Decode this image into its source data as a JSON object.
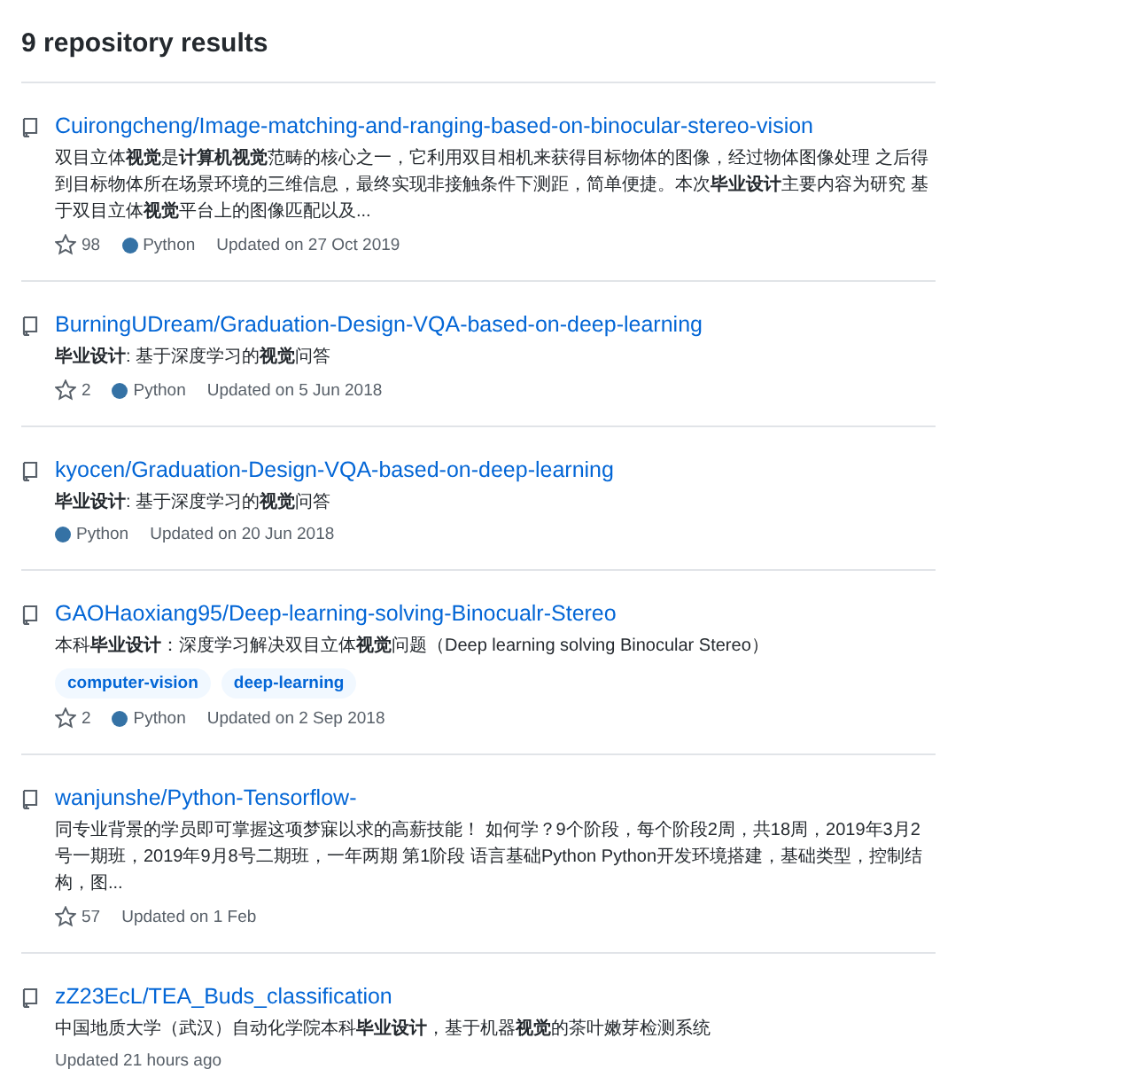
{
  "heading": "9 repository results",
  "repos": [
    {
      "name": "Cuirongcheng/Image-matching-and-ranging-based-on-binocular-stereo-vision",
      "description": "双目立体**视觉**是**计算机视觉**范畴的核心之一，它利用双目相机来获得目标物体的图像，经过物体图像处理 之后得到目标物体所在场景环境的三维信息，最终实现非接触条件下测距，简单便捷。本次**毕业设计**主要内容为研究 基于双目立体**视觉**平台上的图像匹配以及...",
      "stars": "98",
      "language": "Python",
      "color": "#3572a5",
      "updated": "Updated on 27 Oct 2019"
    },
    {
      "name": "BurningUDream/Graduation-Design-VQA-based-on-deep-learning",
      "description": "**毕业设计**: 基于深度学习的**视觉**问答",
      "stars": "2",
      "language": "Python",
      "color": "#3572a5",
      "updated": "Updated on 5 Jun 2018"
    },
    {
      "name": "kyocen/Graduation-Design-VQA-based-on-deep-learning",
      "description": "**毕业设计**: 基于深度学习的**视觉**问答",
      "language": "Python",
      "color": "#3572a5",
      "updated": "Updated on 20 Jun 2018"
    },
    {
      "name": "GAOHaoxiang95/Deep-learning-solving-Binocualr-Stereo",
      "description": "本科**毕业设计**：深度学习解决双目立体**视觉**问题（Deep learning solving Binocular Stereo）",
      "topics": [
        "computer-vision",
        "deep-learning"
      ],
      "stars": "2",
      "language": "Python",
      "color": "#3572a5",
      "updated": "Updated on 2 Sep 2018"
    },
    {
      "name": "wanjunshe/Python-Tensorflow-",
      "description": "同专业背景的学员即可掌握这项梦寐以求的高薪技能！ 如何学？9个阶段，每个阶段2周，共18周，2019年3月2号一期班，2019年9月8号二期班，一年两期 第1阶段 语言基础Python Python开发环境搭建，基础类型，控制结构，图...",
      "stars": "57",
      "updated": "Updated on 1 Feb"
    },
    {
      "name": "zZ23EcL/TEA_Buds_classification",
      "description": "中国地质大学（武汉）自动化学院本科**毕业设计**，基于机器**视觉**的茶叶嫩芽检测系统",
      "updated": "Updated 21 hours ago"
    }
  ]
}
